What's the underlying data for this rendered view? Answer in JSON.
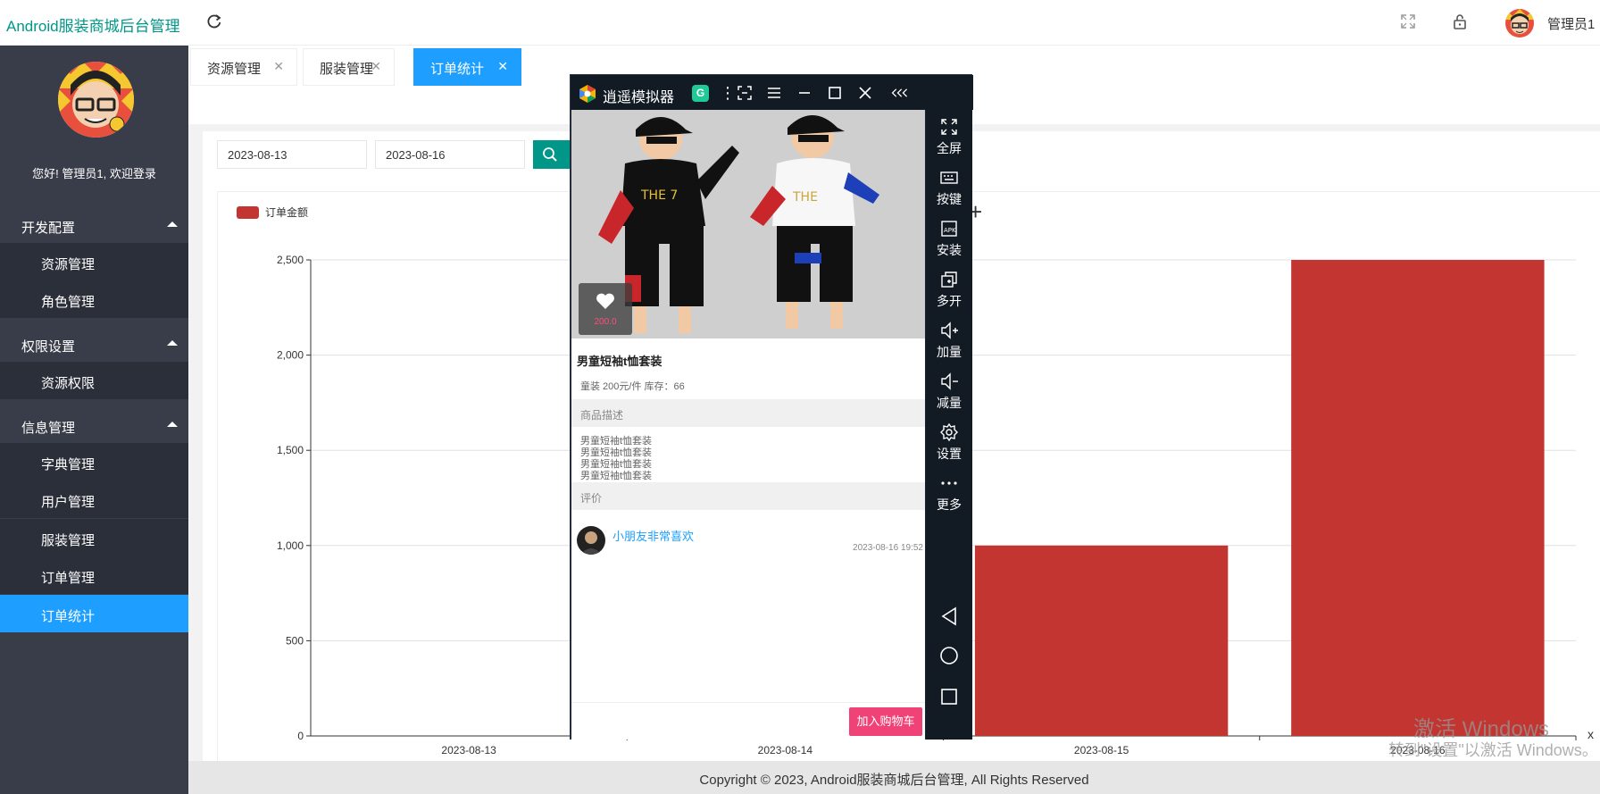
{
  "app": {
    "title": "Android服装商城后台管理",
    "admin_name": "管理员1"
  },
  "sidebar": {
    "welcome": "您好! 管理员1, 欢迎登录",
    "groups": [
      {
        "label": "开发配置",
        "items": [
          "资源管理",
          "角色管理"
        ]
      },
      {
        "label": "权限设置",
        "items": [
          "资源权限"
        ]
      },
      {
        "label": "信息管理",
        "items": [
          "字典管理",
          "用户管理",
          "服装管理",
          "订单管理",
          "订单统计"
        ]
      }
    ],
    "active_item": "订单统计"
  },
  "tabs": [
    {
      "label": "资源管理",
      "close": "✕",
      "active": false
    },
    {
      "label": "服装管理",
      "close": "✕",
      "active": false
    },
    {
      "label": "订单统计",
      "close": "✕",
      "active": true
    }
  ],
  "filters": {
    "start_date": "2023-08-13",
    "end_date": "2023-08-16"
  },
  "chart_data": {
    "type": "bar",
    "categories": [
      "2023-08-13",
      "2023-08-14",
      "2023-08-15",
      "2023-08-16"
    ],
    "series": [
      {
        "name": "订单金额",
        "values": [
          0,
          0,
          1000,
          2500
        ],
        "color": "#c23531"
      }
    ],
    "ylim": [
      0,
      2500
    ],
    "yticks": [
      "0",
      "500",
      "1,000",
      "1,500",
      "2,000",
      "2,500"
    ],
    "grid": true,
    "legend": "top-left"
  },
  "footer": "Copyright © 2023, Android服装商城后台管理, All Rights Reserved",
  "watermark": {
    "line1": "激活 Windows",
    "line2": "转到\"设置\"以激活 Windows。"
  },
  "emulator": {
    "name": "逍遥模拟器",
    "badge": "G",
    "side_buttons": [
      "全屏",
      "按键",
      "安装",
      "多开",
      "加量",
      "减量",
      "设置",
      "更多"
    ],
    "product": {
      "name": "男童短袖t恤套装",
      "likes": "200.0",
      "meta": "童装  200元/件 库存：66",
      "desc_title": "商品描述",
      "desc_lines": [
        "男童短袖t恤套装",
        "男童短袖t恤套装",
        "男童短袖t恤套装",
        "男童短袖t恤套装"
      ],
      "review_title": "评价",
      "comment": "小朋友非常喜欢",
      "comment_time": "2023-08-16 19:52",
      "cart_button": "加入购物车"
    }
  },
  "colors": {
    "accent": "#009688",
    "active": "#1e9fff",
    "sidebar": "#393d49",
    "bar": "#c23531",
    "cart": "#f04277"
  }
}
